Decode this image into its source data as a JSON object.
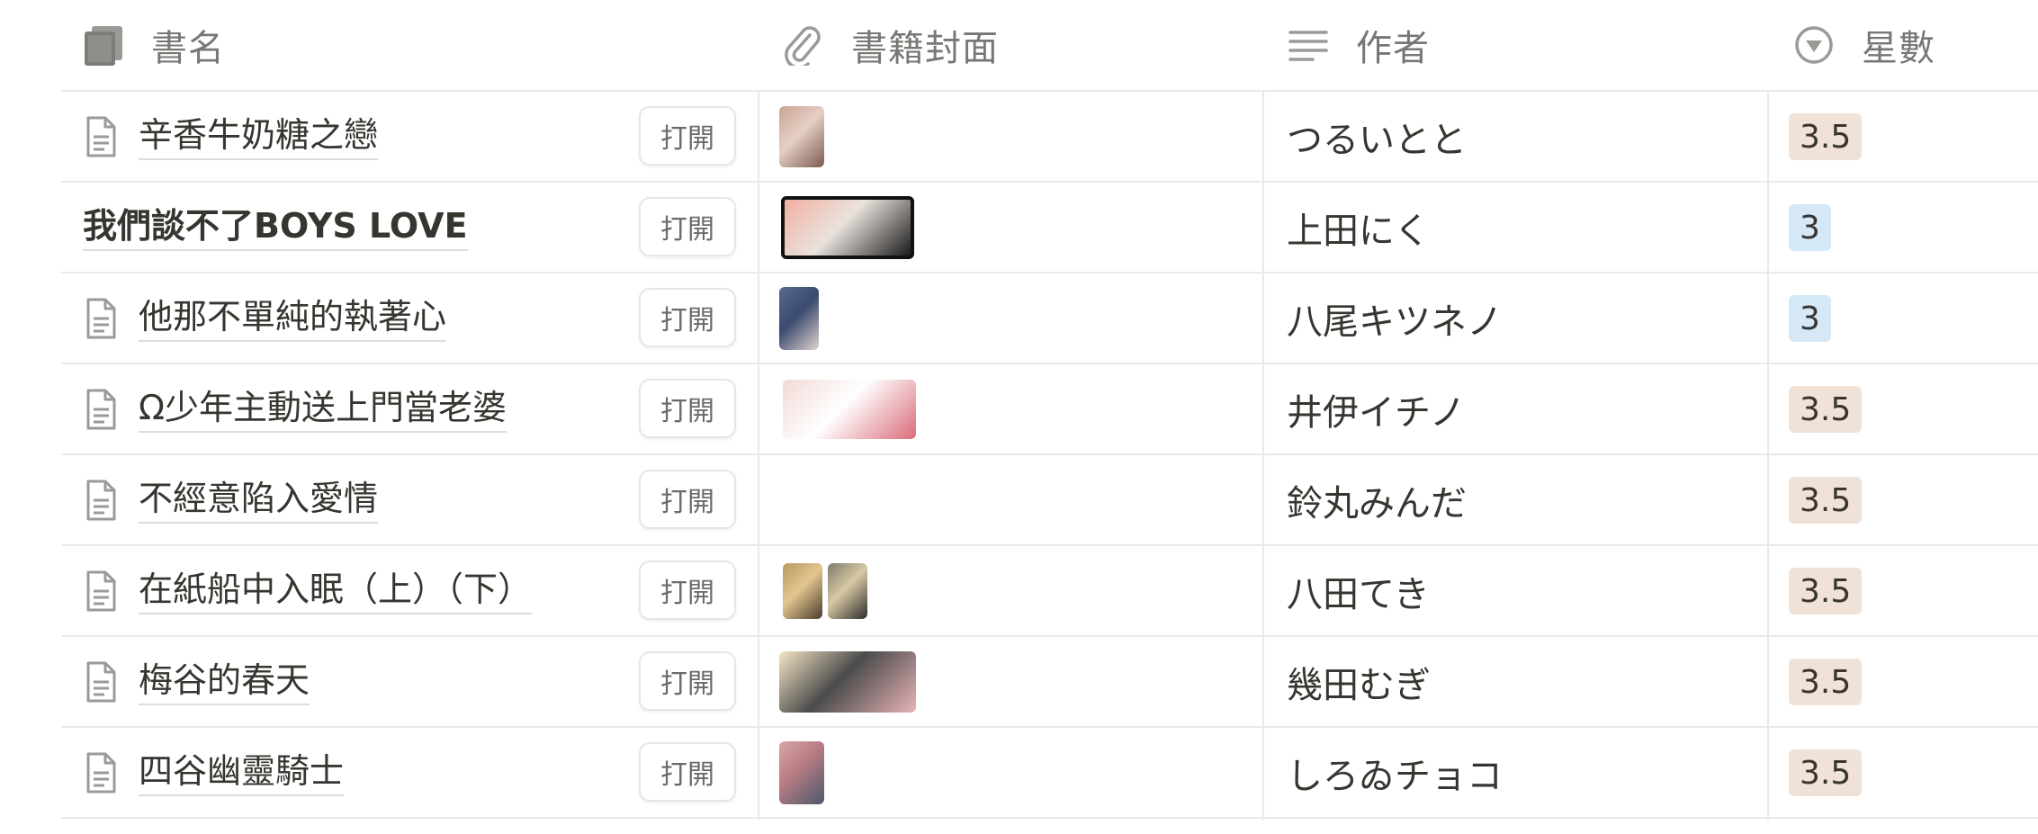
{
  "columns": {
    "title": {
      "label": "書名",
      "icon": "book-stack-icon"
    },
    "cover": {
      "label": "書籍封面",
      "icon": "paperclip-icon"
    },
    "author": {
      "label": "作者",
      "icon": "text-lines-icon"
    },
    "rating": {
      "label": "星數",
      "icon": "select-circle-icon"
    }
  },
  "open_label": "打開",
  "rating_colors": {
    "3.5": "#f0e2d7",
    "3": "#d5e8f5"
  },
  "rows": [
    {
      "title": "辛香牛奶糖之戀",
      "has_doc_icon": true,
      "author": "つるいとと",
      "rating": "3.5"
    },
    {
      "title": "我們談不了BOYS LOVE",
      "has_doc_icon": false,
      "author": "上田にく",
      "rating": "3"
    },
    {
      "title": "他那不單純的執著心",
      "has_doc_icon": true,
      "author": "八尾キツネノ",
      "rating": "3"
    },
    {
      "title": "Ω少年主動送上門當老婆",
      "has_doc_icon": true,
      "author": "井伊イチノ",
      "rating": "3.5"
    },
    {
      "title": "不經意陷入愛情",
      "has_doc_icon": true,
      "author": "鈴丸みんだ",
      "rating": "3.5"
    },
    {
      "title": "在紙船中入眠（上）（下）",
      "has_doc_icon": true,
      "author": "八田てき",
      "rating": "3.5"
    },
    {
      "title": "梅谷的春天",
      "has_doc_icon": true,
      "author": "幾田むぎ",
      "rating": "3.5"
    },
    {
      "title": "四谷幽靈騎士",
      "has_doc_icon": true,
      "author": "しろゐチョコ",
      "rating": "3.5"
    }
  ]
}
